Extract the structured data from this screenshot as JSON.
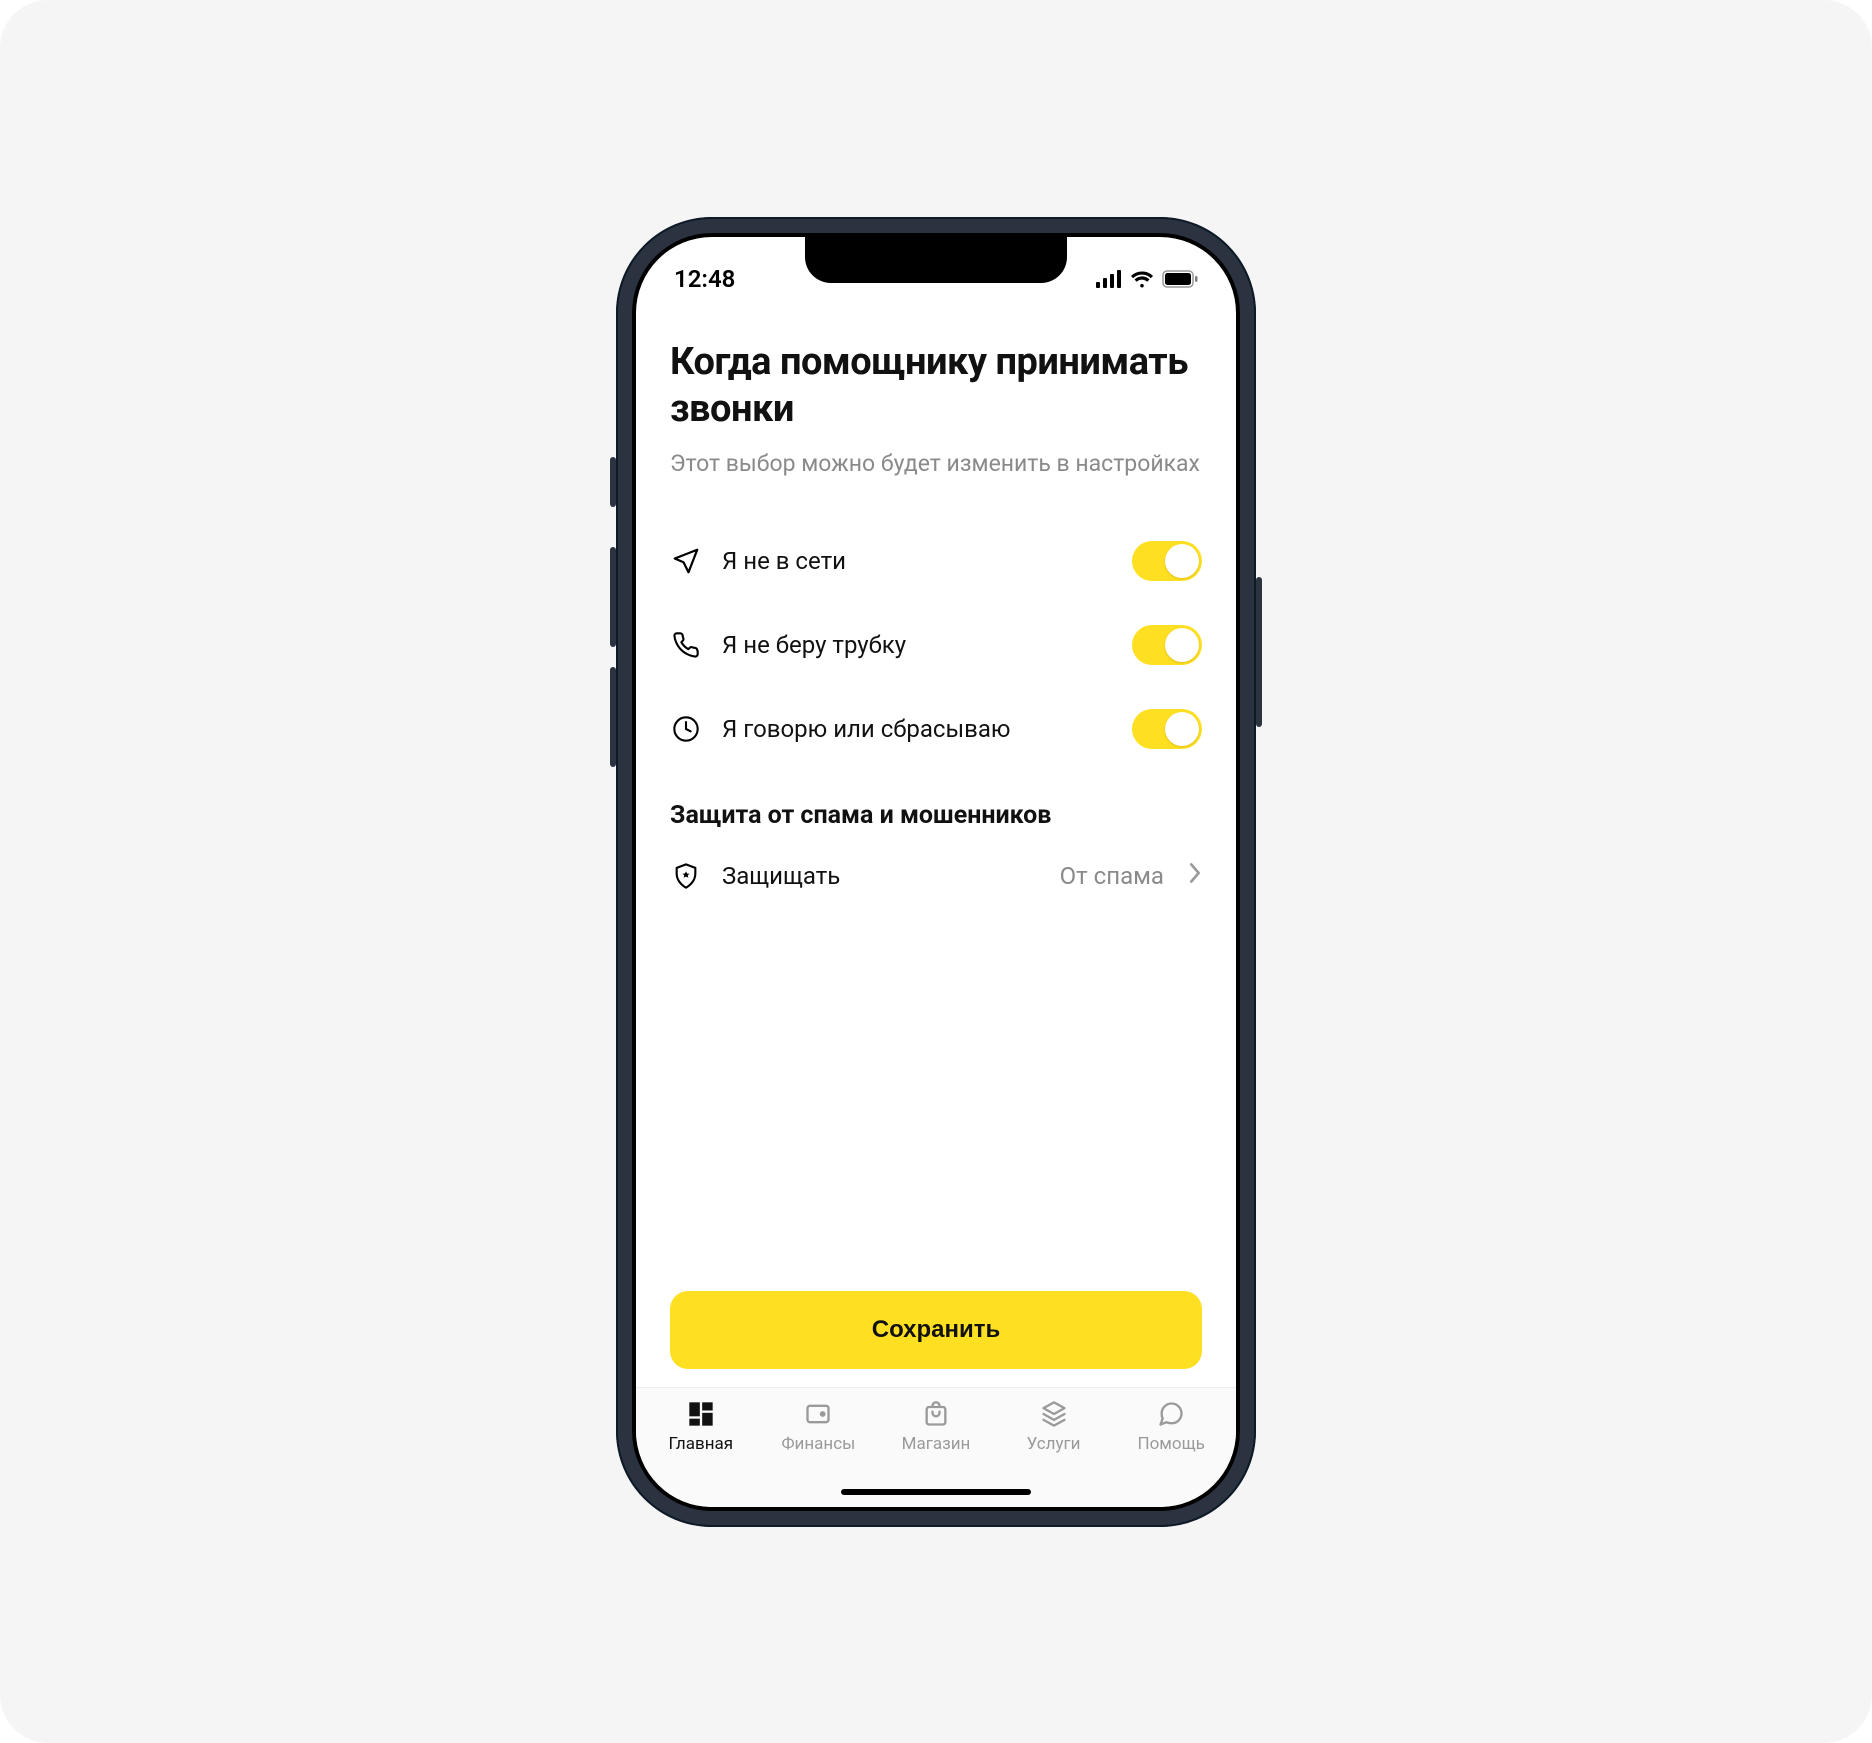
{
  "status": {
    "time": "12:48"
  },
  "header": {
    "title": "Когда помощнику принимать звонки",
    "subtitle": "Этот выбор можно будет изменить в настройках"
  },
  "toggles": [
    {
      "icon": "airplane-icon",
      "label": "Я не в сети",
      "on": true
    },
    {
      "icon": "phone-icon",
      "label": "Я не беру трубку",
      "on": true
    },
    {
      "icon": "clock-icon",
      "label": "Я говорю или сбрасываю",
      "on": true
    }
  ],
  "spam": {
    "section_title": "Защита от спама и мошенников",
    "item": {
      "icon": "shield-icon",
      "label": "Защищать",
      "value": "От спама"
    }
  },
  "actions": {
    "save": "Сохранить"
  },
  "tabs": [
    {
      "icon": "home-icon",
      "label": "Главная",
      "active": true
    },
    {
      "icon": "wallet-icon",
      "label": "Финансы",
      "active": false
    },
    {
      "icon": "bag-icon",
      "label": "Магазин",
      "active": false
    },
    {
      "icon": "layers-icon",
      "label": "Услуги",
      "active": false
    },
    {
      "icon": "chat-icon",
      "label": "Помощь",
      "active": false
    }
  ],
  "colors": {
    "accent": "#ffdf22",
    "phone_frame": "#2b3340"
  }
}
